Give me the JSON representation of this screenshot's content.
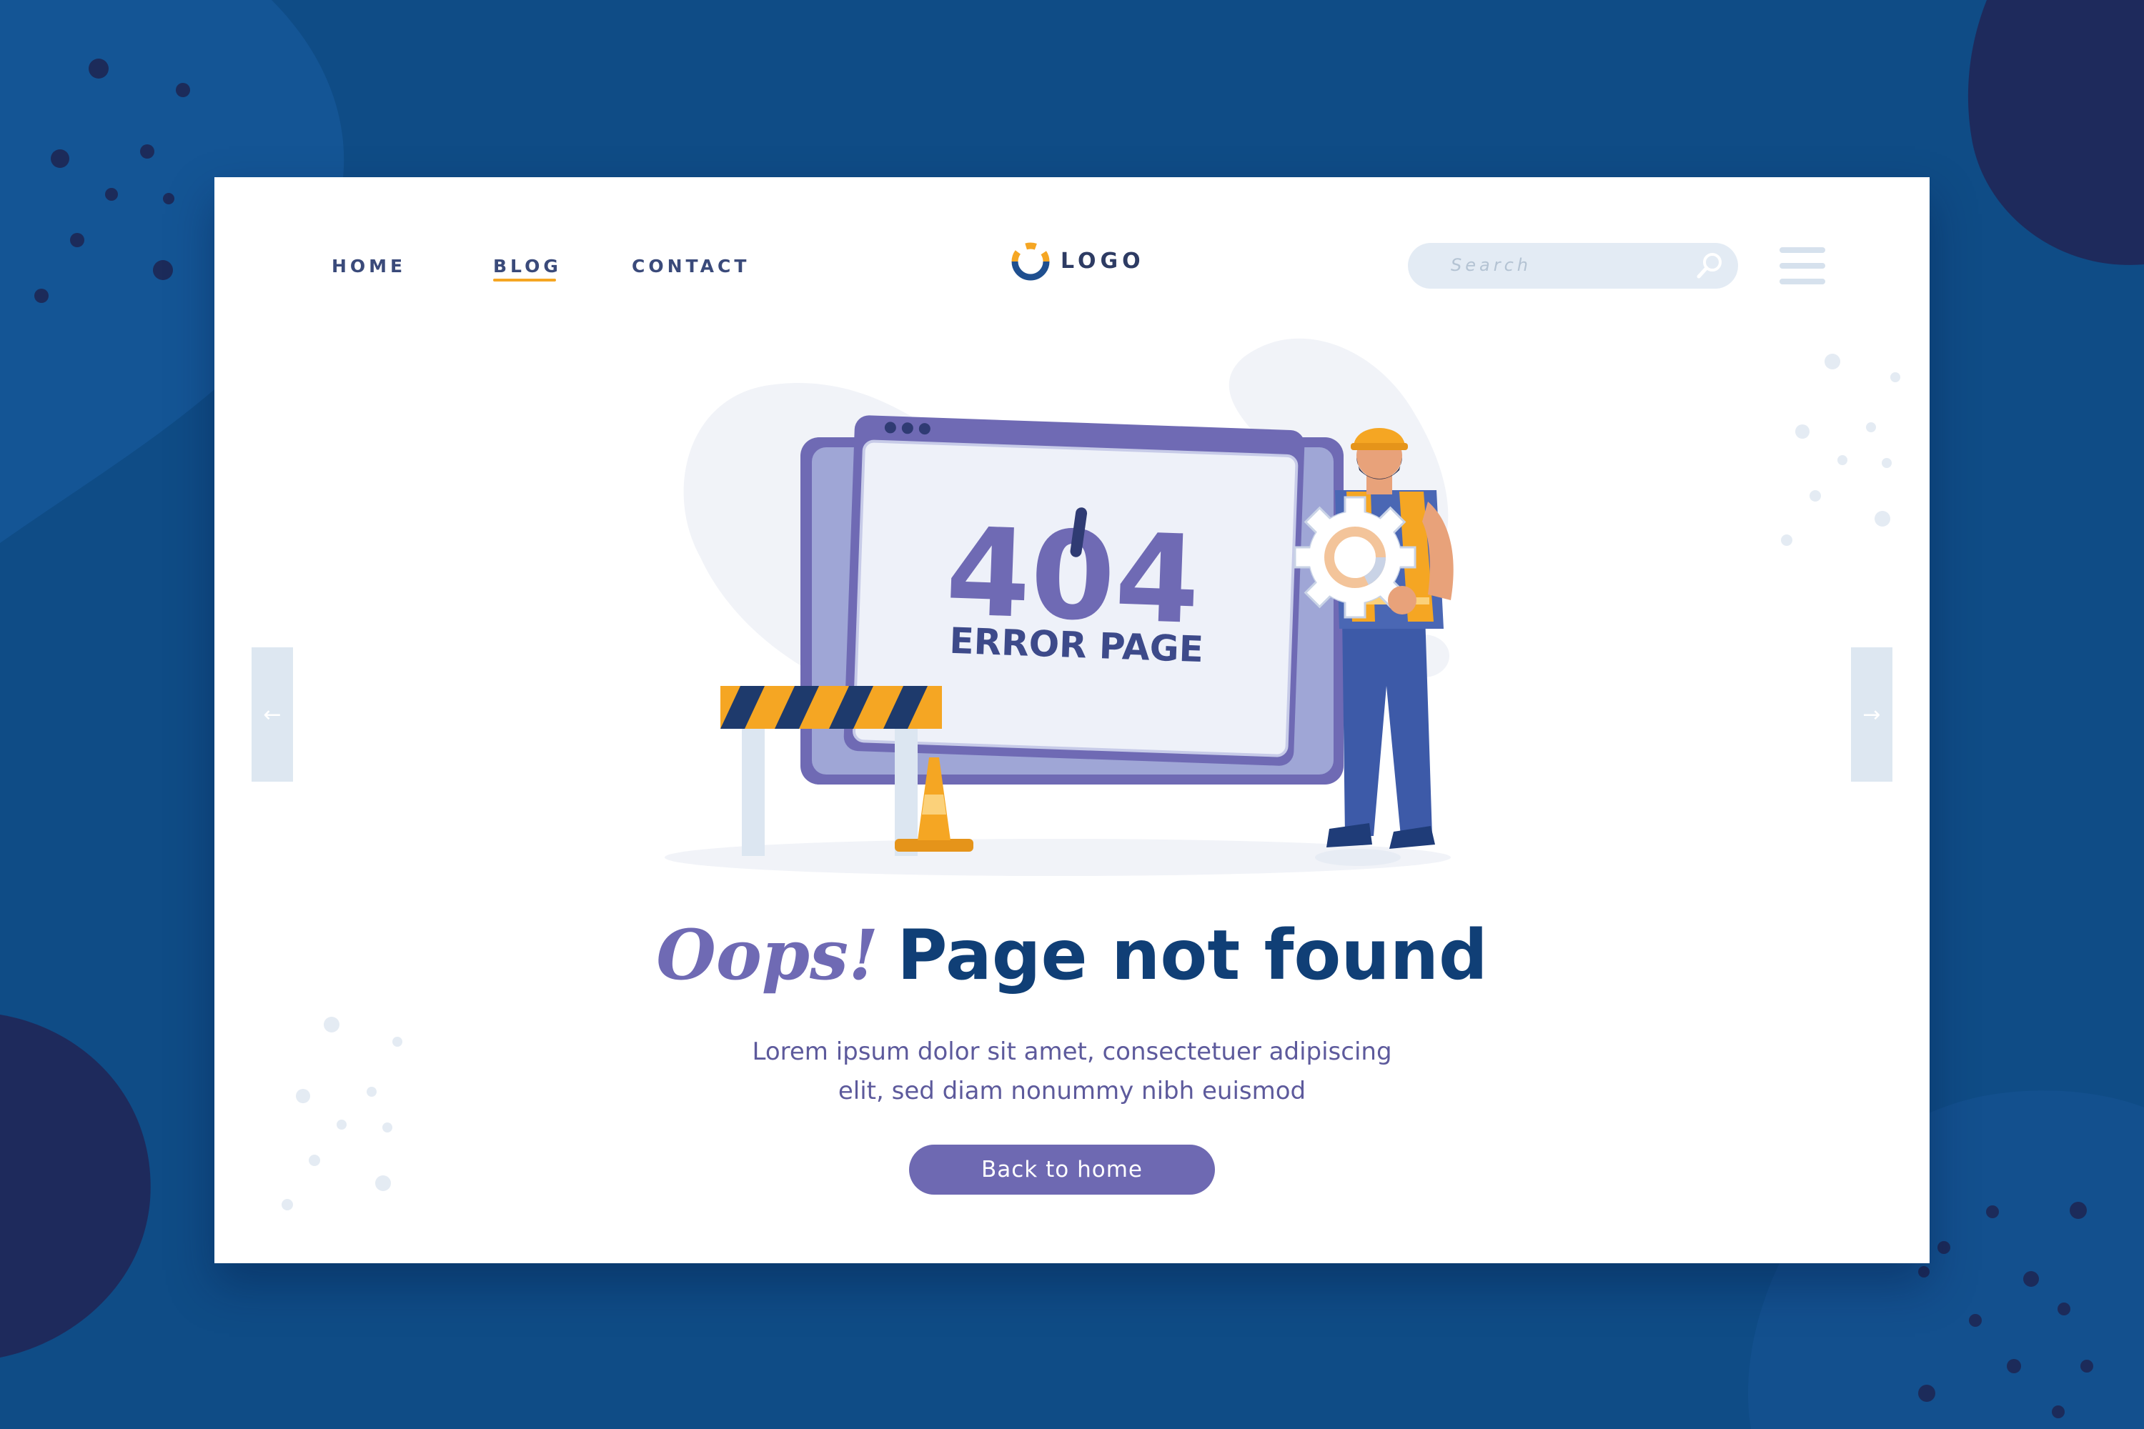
{
  "nav": {
    "home": "HOME",
    "blog": "BLOG",
    "contact": "CONTACT",
    "active_item": "BLOG"
  },
  "logo": {
    "text": "LOGO",
    "icon": "ring-logo-icon"
  },
  "search": {
    "placeholder": "Search",
    "icon": "search-icon"
  },
  "menu": {
    "icon": "hamburger-menu-icon"
  },
  "carousel": {
    "prev_icon": "arrow-left-icon",
    "next_icon": "arrow-right-icon"
  },
  "illustration": {
    "code": "404",
    "caption": "ERROR PAGE"
  },
  "message": {
    "oops": "Oops!",
    "title": "Page not found",
    "line1": "Lorem ipsum dolor sit amet, consectetuer adipiscing",
    "line2": "elit, sed diam nonummy nibh euismod"
  },
  "cta": {
    "label": "Back to home"
  },
  "colors": {
    "background": "#0f4c86",
    "card": "#ffffff",
    "accent": "#6e69b2",
    "title": "#103f76",
    "highlight": "#f5a623"
  }
}
